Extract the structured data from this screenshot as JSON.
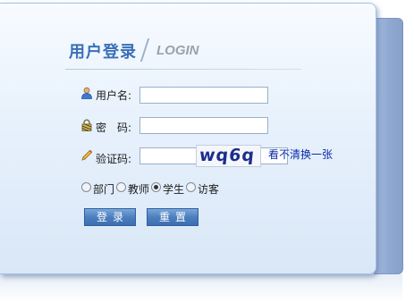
{
  "header": {
    "title_cn": "用户登录",
    "title_en": "LOGIN"
  },
  "form": {
    "username_label": "用户名:",
    "password_label": "密　码:",
    "captcha_label": "验证码:",
    "username_value": "",
    "password_value": "",
    "captcha_value": "",
    "captcha_image_text": "wq6q",
    "captcha_refresh_link": "看不清换一张"
  },
  "roles": [
    {
      "label": "部门",
      "checked": false
    },
    {
      "label": "教师",
      "checked": false
    },
    {
      "label": "学生",
      "checked": true
    },
    {
      "label": "访客",
      "checked": false
    }
  ],
  "buttons": {
    "login": "登录",
    "reset": "重置"
  },
  "colors": {
    "title": "#3a6fb8",
    "button": "#4c7fbf",
    "link": "#0b2aa8"
  },
  "icons": [
    "user-icon",
    "lock-icon",
    "pencil-icon"
  ]
}
